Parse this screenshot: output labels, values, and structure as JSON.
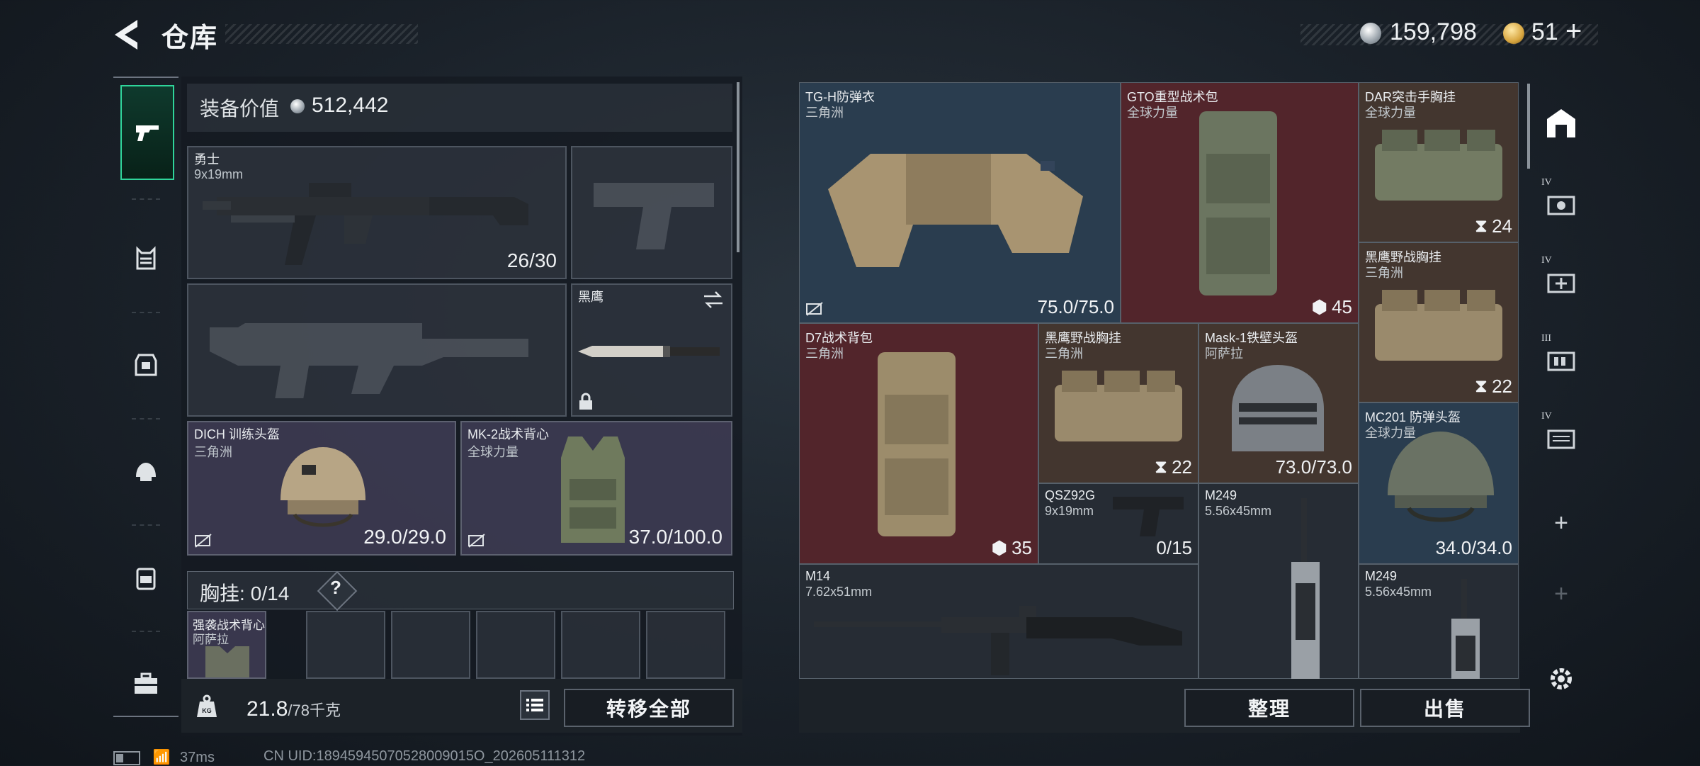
{
  "header": {
    "title": "仓库"
  },
  "currency": {
    "silver": "159,798",
    "gold": "51",
    "gold_plus": "+"
  },
  "equipment": {
    "value_label": "装备价值",
    "value": "512,442",
    "primary_weapon": {
      "name": "勇士",
      "caliber": "9x19mm",
      "ammo": "26/30"
    },
    "melee": {
      "name": "黑鹰"
    },
    "helmet": {
      "name": "DICH 训练头盔",
      "origin": "三角洲",
      "durability": "29.0/29.0"
    },
    "armor": {
      "name": "MK-2战术背心",
      "origin": "全球力量",
      "durability": "37.0/100.0"
    },
    "chest_rig": {
      "label": "胸挂:",
      "capacity": "0/14",
      "help": "?",
      "item_name": "强袭战术背心",
      "item_origin": "阿萨拉"
    },
    "weight": {
      "current": "21.8",
      "max": "/78千克"
    },
    "transfer_all": "转移全部"
  },
  "storage": {
    "items": [
      {
        "name": "TG-H防弹衣",
        "origin": "三角洲",
        "value": "75.0/75.0"
      },
      {
        "name": "GTO重型战术包",
        "origin": "全球力量",
        "value": "45"
      },
      {
        "name": "DAR突击手胸挂",
        "origin": "全球力量",
        "value": "24"
      },
      {
        "name": "黑鹰野战胸挂",
        "origin": "三角洲",
        "value": "22"
      },
      {
        "name": "D7战术背包",
        "origin": "三角洲",
        "value": "35"
      },
      {
        "name": "黑鹰野战胸挂",
        "origin": "三角洲",
        "value": "22"
      },
      {
        "name": "Mask-1铁壁头盔",
        "origin": "阿萨拉",
        "value": "73.0/73.0"
      },
      {
        "name": "MC201 防弹头盔",
        "origin": "全球力量",
        "value": "34.0/34.0"
      },
      {
        "name": "QSZ92G",
        "origin": "9x19mm",
        "value": "0/15"
      },
      {
        "name": "M249",
        "origin": "5.56x45mm"
      },
      {
        "name": "M14",
        "origin": "7.62x51mm"
      },
      {
        "name": "M249",
        "origin": "5.56x45mm"
      }
    ],
    "sort_button": "整理",
    "sell_button": "出售"
  },
  "side_tabs": {
    "lv4": "IV",
    "lv4b": "IV",
    "lv3": "III",
    "lv4c": "IV",
    "plus": "+"
  },
  "status_bar": {
    "ping": "37ms",
    "uid": "CN UID:18945945070528009015O_202605111312"
  },
  "colors": {
    "accent_green": "#2fd49a",
    "slot_blue": "#2d4256",
    "slot_red": "#5c262c",
    "slot_brown": "#4a3a30"
  }
}
